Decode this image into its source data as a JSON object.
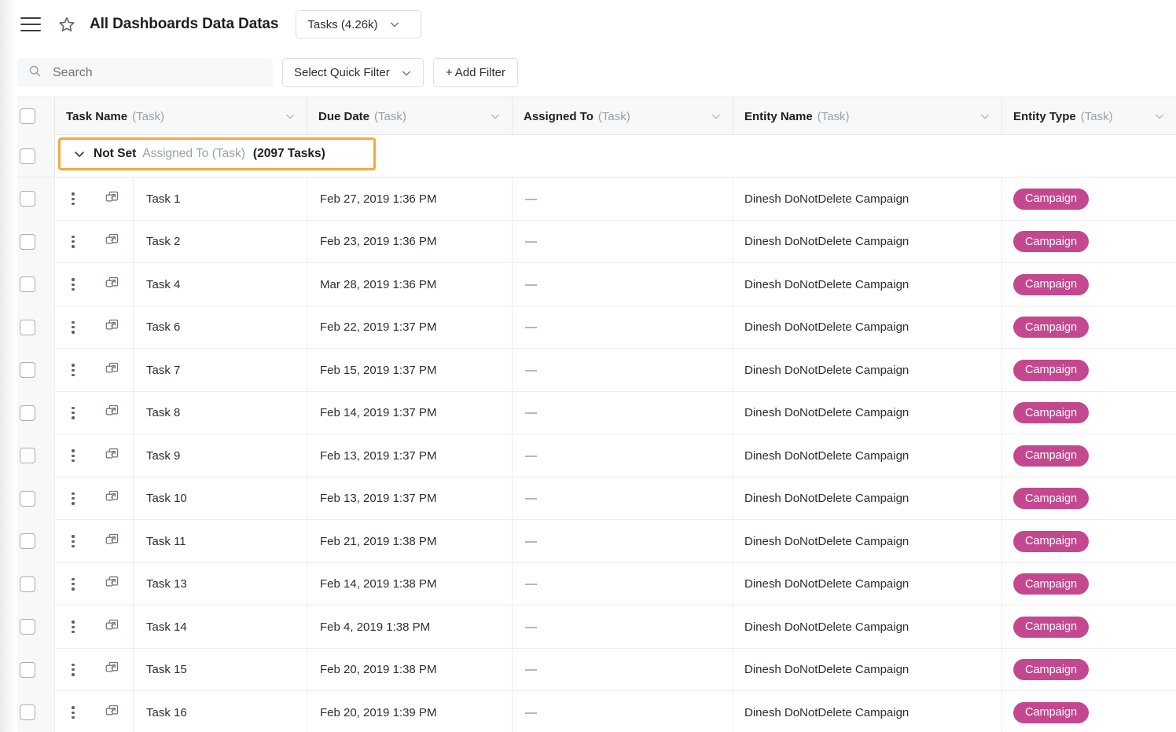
{
  "topbar": {
    "menu_icon": "hamburger-menu-icon",
    "favorite_icon": "star-outline-icon",
    "title": "All Dashboards Data Datas",
    "entity_select": {
      "label": "Tasks (4.26k)",
      "chevron_icon": "chevron-down-icon"
    }
  },
  "filterbar": {
    "search": {
      "icon": "search-icon",
      "placeholder": "Search",
      "value": ""
    },
    "quick_filter": {
      "label": "Select Quick Filter",
      "chevron_icon": "chevron-down-icon"
    },
    "add_filter": {
      "label": "+ Add Filter"
    }
  },
  "grid": {
    "select_all_checkbox": "unchecked",
    "columns": [
      {
        "label": "Task Name",
        "sub": "(Task)",
        "chevron_icon": "chevron-down-icon"
      },
      {
        "label": "Due Date",
        "sub": "(Task)",
        "chevron_icon": "chevron-down-icon"
      },
      {
        "label": "Assigned To",
        "sub": "(Task)",
        "chevron_icon": "chevron-down-icon"
      },
      {
        "label": "Entity Name",
        "sub": "(Task)",
        "chevron_icon": "chevron-down-icon"
      },
      {
        "label": "Entity Type",
        "sub": "(Task)",
        "chevron_icon": "chevron-down-icon"
      }
    ],
    "group": {
      "expand_icon": "chevron-down-icon",
      "value": "Not Set",
      "field": "Assigned To (Task)",
      "count": "(2097 Tasks)",
      "highlight_color": "#f4a93f",
      "highlighted": true
    },
    "row_icons": {
      "menu_icon": "kebab-menu-icon",
      "open_icon": "open-in-new-window-icon"
    },
    "badge_color": "#c4488f",
    "empty_value": "—",
    "rows": [
      {
        "name": "Task 1",
        "due": "Feb 27, 2019 1:36 PM",
        "assigned": "—",
        "entity_name": "Dinesh DoNotDelete Campaign",
        "entity_type": "Campaign"
      },
      {
        "name": "Task 2",
        "due": "Feb 23, 2019 1:36 PM",
        "assigned": "—",
        "entity_name": "Dinesh DoNotDelete Campaign",
        "entity_type": "Campaign"
      },
      {
        "name": "Task 4",
        "due": "Mar 28, 2019 1:36 PM",
        "assigned": "—",
        "entity_name": "Dinesh DoNotDelete Campaign",
        "entity_type": "Campaign"
      },
      {
        "name": "Task 6",
        "due": "Feb 22, 2019 1:37 PM",
        "assigned": "—",
        "entity_name": "Dinesh DoNotDelete Campaign",
        "entity_type": "Campaign"
      },
      {
        "name": "Task 7",
        "due": "Feb 15, 2019 1:37 PM",
        "assigned": "—",
        "entity_name": "Dinesh DoNotDelete Campaign",
        "entity_type": "Campaign"
      },
      {
        "name": "Task 8",
        "due": "Feb 14, 2019 1:37 PM",
        "assigned": "—",
        "entity_name": "Dinesh DoNotDelete Campaign",
        "entity_type": "Campaign"
      },
      {
        "name": "Task 9",
        "due": "Feb 13, 2019 1:37 PM",
        "assigned": "—",
        "entity_name": "Dinesh DoNotDelete Campaign",
        "entity_type": "Campaign"
      },
      {
        "name": "Task 10",
        "due": "Feb 13, 2019 1:37 PM",
        "assigned": "—",
        "entity_name": "Dinesh DoNotDelete Campaign",
        "entity_type": "Campaign"
      },
      {
        "name": "Task 11",
        "due": "Feb 21, 2019 1:38 PM",
        "assigned": "—",
        "entity_name": "Dinesh DoNotDelete Campaign",
        "entity_type": "Campaign"
      },
      {
        "name": "Task 13",
        "due": "Feb 14, 2019 1:38 PM",
        "assigned": "—",
        "entity_name": "Dinesh DoNotDelete Campaign",
        "entity_type": "Campaign"
      },
      {
        "name": "Task 14",
        "due": "Feb 4, 2019 1:38 PM",
        "assigned": "—",
        "entity_name": "Dinesh DoNotDelete Campaign",
        "entity_type": "Campaign"
      },
      {
        "name": "Task 15",
        "due": "Feb 20, 2019 1:38 PM",
        "assigned": "—",
        "entity_name": "Dinesh DoNotDelete Campaign",
        "entity_type": "Campaign"
      },
      {
        "name": "Task 16",
        "due": "Feb 20, 2019 1:39 PM",
        "assigned": "—",
        "entity_name": "Dinesh DoNotDelete Campaign",
        "entity_type": "Campaign"
      }
    ]
  }
}
